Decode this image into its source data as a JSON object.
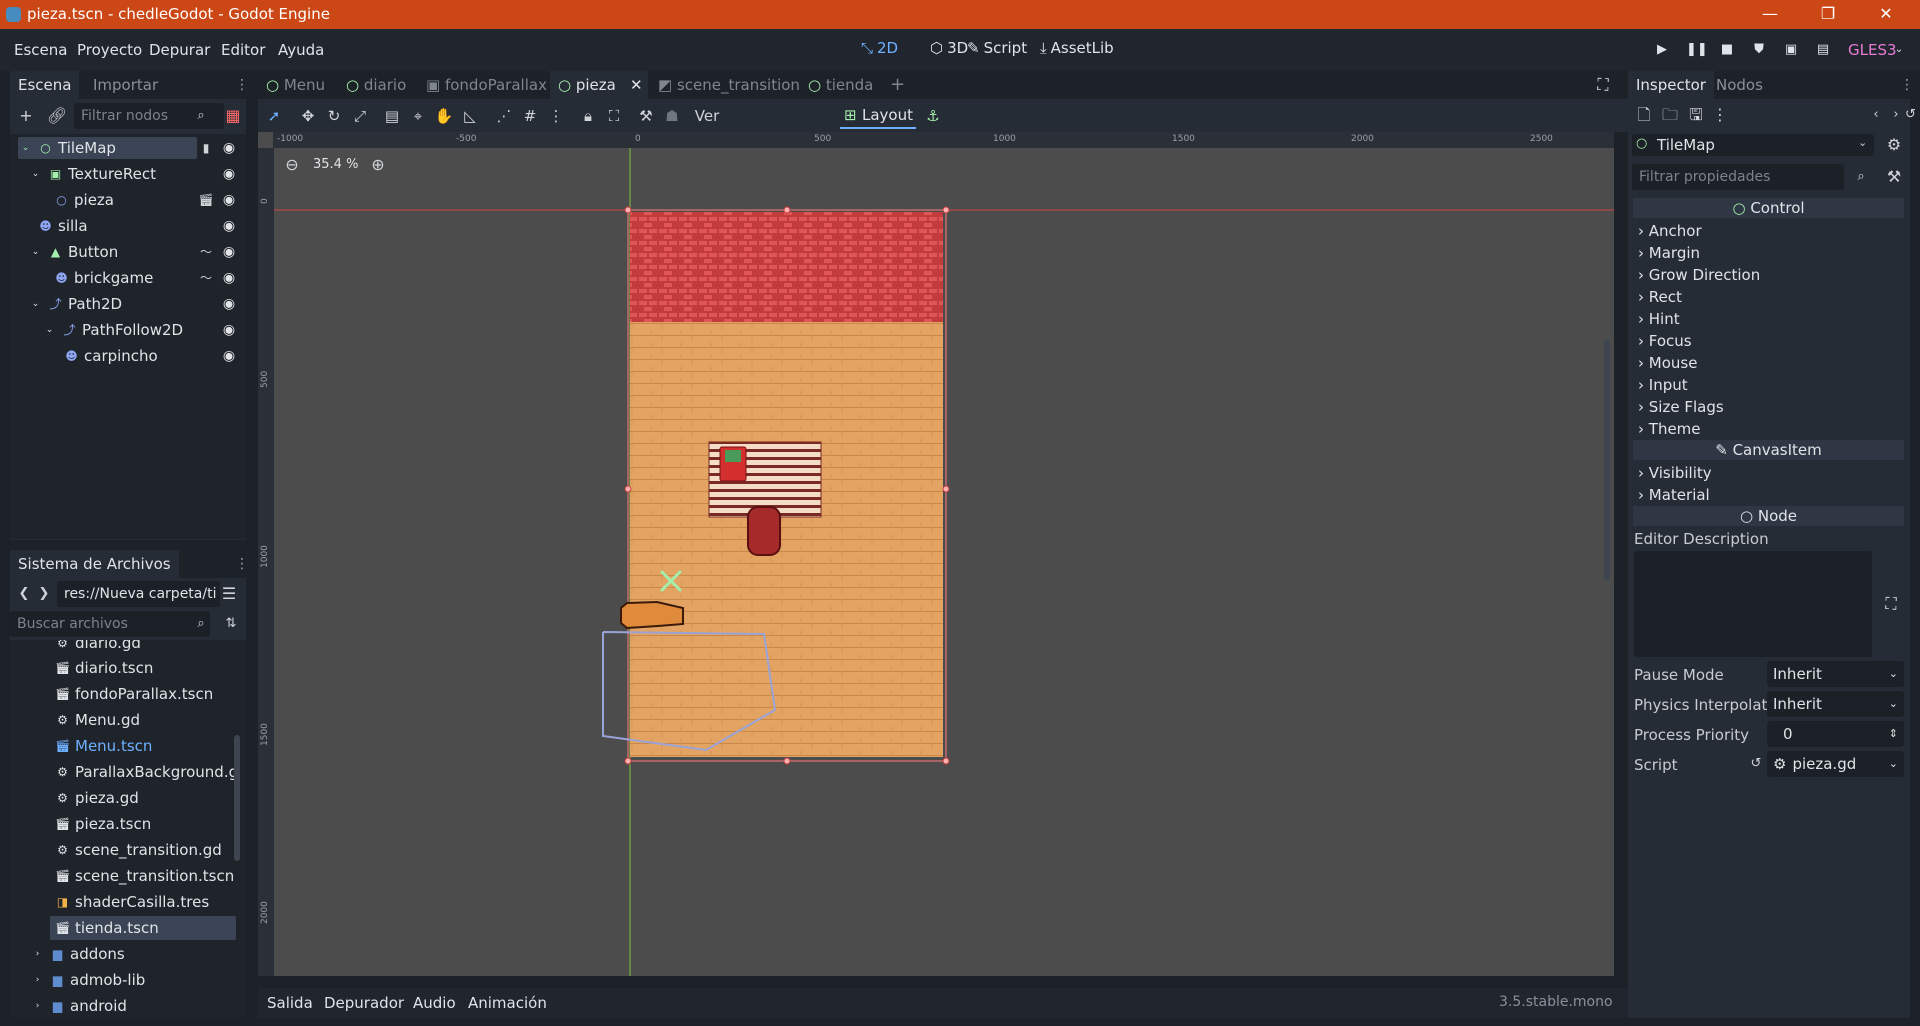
{
  "window": {
    "title": "pieza.tscn - chedleGodot - Godot Engine",
    "controls": {
      "minimize": "—",
      "restore": "❐",
      "close": "✕"
    }
  },
  "menu": {
    "items": [
      "Escena",
      "Proyecto",
      "Depurar",
      "Editor",
      "Ayuda"
    ],
    "main_screens": [
      "2D",
      "3D",
      "Script",
      "AssetLib"
    ],
    "renderer": "GLES3"
  },
  "scene_dock": {
    "tabs": [
      "Escena",
      "Importar"
    ],
    "filter_placeholder": "Filtrar nodos",
    "tree": [
      {
        "label": "TileMap"
      },
      {
        "label": "TextureRect"
      },
      {
        "label": "pieza"
      },
      {
        "label": "silla"
      },
      {
        "label": "Button"
      },
      {
        "label": "brickgame"
      },
      {
        "label": "Path2D"
      },
      {
        "label": "PathFollow2D"
      },
      {
        "label": "carpincho"
      }
    ]
  },
  "filesystem_dock": {
    "title": "Sistema de Archivos",
    "path": "res://Nueva carpeta/ti",
    "search_placeholder": "Buscar archivos",
    "files": [
      {
        "label": "diario.gd"
      },
      {
        "label": "diario.tscn"
      },
      {
        "label": "fondoParallax.tscn"
      },
      {
        "label": "Menu.gd"
      },
      {
        "label": "Menu.tscn"
      },
      {
        "label": "ParallaxBackground.g"
      },
      {
        "label": "pieza.gd"
      },
      {
        "label": "pieza.tscn"
      },
      {
        "label": "scene_transition.gd"
      },
      {
        "label": "scene_transition.tscn"
      },
      {
        "label": "shaderCasilla.tres"
      },
      {
        "label": "tienda.tscn"
      },
      {
        "label": "addons"
      },
      {
        "label": "admob-lib"
      },
      {
        "label": "android"
      }
    ]
  },
  "scene_tabs": [
    "Menu",
    "diario",
    "fondoParallax",
    "pieza",
    "scene_transition",
    "tienda"
  ],
  "toolbar": {
    "view_label": "Ver",
    "layout_label": "Layout"
  },
  "viewport": {
    "zoom": "35.4 %",
    "ruler_h": [
      "-1000",
      "-500",
      "0",
      "500",
      "1000",
      "1500",
      "2000",
      "2500"
    ],
    "ruler_v": [
      "0",
      "500",
      "1000",
      "1500",
      "2000"
    ]
  },
  "bottom_panel": {
    "tabs": [
      "Salida",
      "Depurador",
      "Audio",
      "Animación"
    ],
    "version": "3.5.stable.mono"
  },
  "inspector": {
    "tabs": [
      "Inspector",
      "Nodos"
    ],
    "node": "TileMap",
    "filter_placeholder": "Filtrar propiedades",
    "sections": {
      "control": "Control",
      "canvas_item": "CanvasItem",
      "node": "Node"
    },
    "control_props": [
      "Anchor",
      "Margin",
      "Grow Direction",
      "Rect",
      "Hint",
      "Focus",
      "Mouse",
      "Input",
      "Size Flags",
      "Theme"
    ],
    "canvas_props": [
      "Visibility",
      "Material"
    ],
    "editor_description": "Editor Description",
    "props": [
      {
        "label": "Pause Mode",
        "value": "Inherit"
      },
      {
        "label": "Physics Interpolati",
        "value": "Inherit"
      },
      {
        "label": "Process Priority",
        "value": "0"
      },
      {
        "label": "Script",
        "value": "pieza.gd"
      }
    ]
  }
}
